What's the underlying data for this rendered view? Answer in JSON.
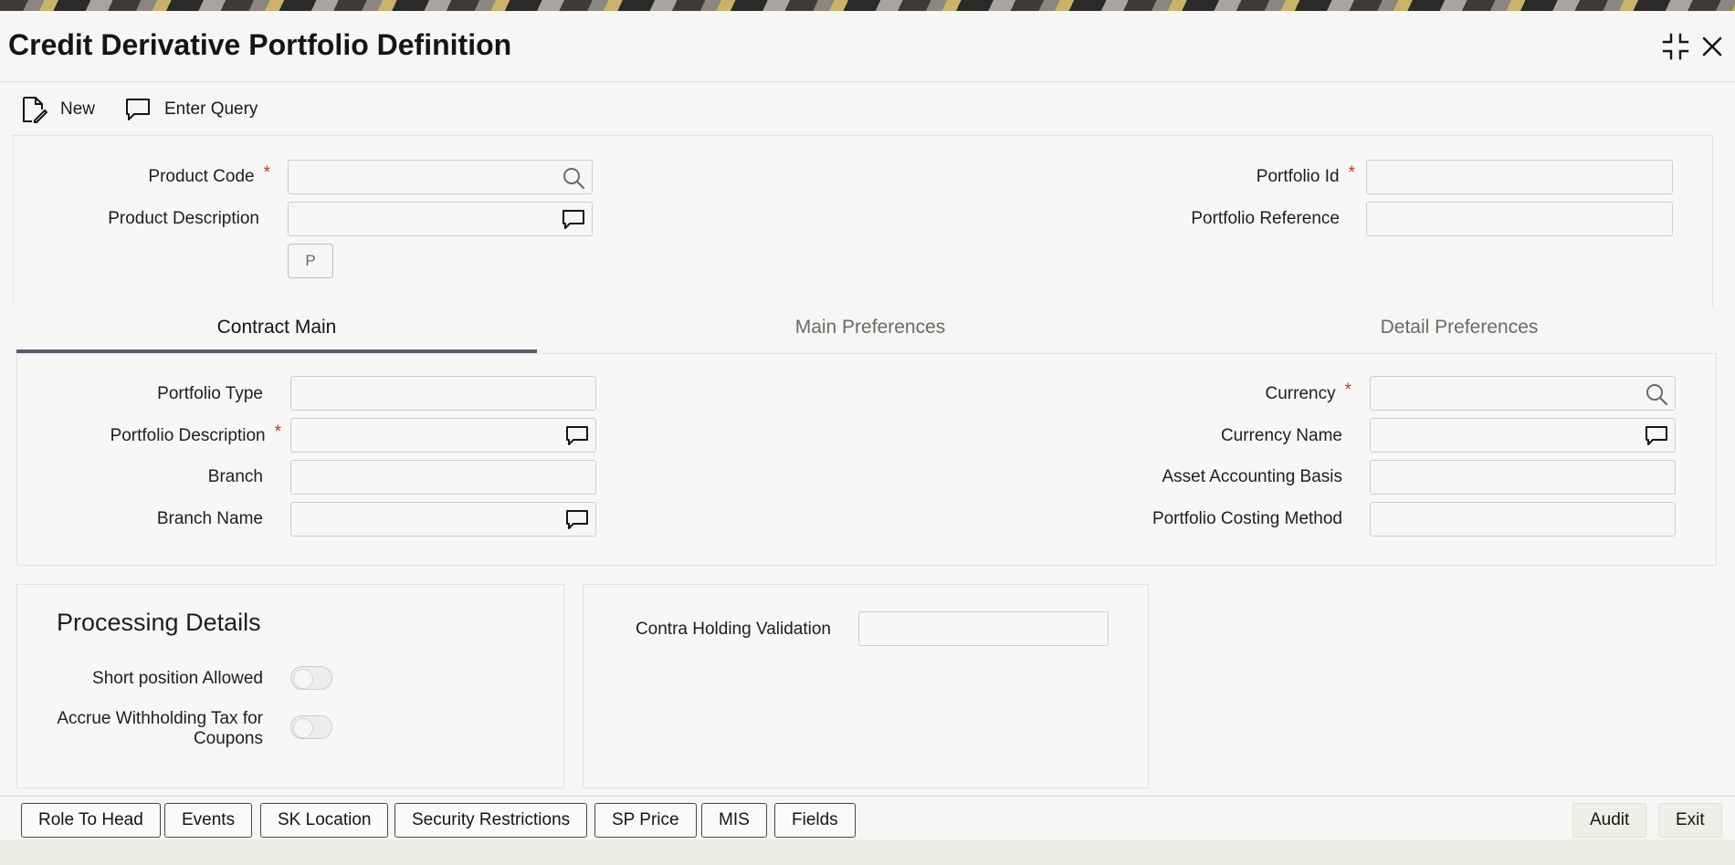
{
  "window": {
    "title": "Credit Derivative Portfolio Definition",
    "maximize_icon": "maximize-icon",
    "close_icon": "close-icon"
  },
  "toolbar": {
    "new_label": "New",
    "enter_query_label": "Enter Query"
  },
  "header": {
    "product_code_label": "Product Code",
    "product_code_value": "",
    "product_description_label": "Product Description",
    "product_description_value": "",
    "p_button_label": "P",
    "portfolio_id_label": "Portfolio Id",
    "portfolio_id_value": "",
    "portfolio_reference_label": "Portfolio Reference",
    "portfolio_reference_value": "",
    "required_mark": "*"
  },
  "tabs": [
    {
      "label": "Contract Main",
      "active": true
    },
    {
      "label": "Main Preferences",
      "active": false
    },
    {
      "label": "Detail Preferences",
      "active": false
    }
  ],
  "contract_main": {
    "portfolio_type_label": "Portfolio Type",
    "portfolio_type_value": "",
    "portfolio_description_label": "Portfolio Description",
    "portfolio_description_value": "",
    "branch_label": "Branch",
    "branch_value": "",
    "branch_name_label": "Branch Name",
    "branch_name_value": "",
    "currency_label": "Currency",
    "currency_value": "",
    "currency_name_label": "Currency Name",
    "currency_name_value": "",
    "asset_accounting_basis_label": "Asset Accounting Basis",
    "asset_accounting_basis_value": "",
    "portfolio_costing_method_label": "Portfolio Costing Method",
    "portfolio_costing_method_value": ""
  },
  "processing": {
    "heading": "Processing Details",
    "short_position_label": "Short position Allowed",
    "short_position_on": false,
    "accrue_wht_label_line1": "Accrue Withholding Tax for",
    "accrue_wht_label_line2": "Coupons",
    "accrue_wht_on": false,
    "contra_holding_label": "Contra Holding Validation",
    "contra_holding_value": ""
  },
  "footer": {
    "buttons": [
      "Role To Head",
      "Events",
      "SK Location",
      "Security Restrictions",
      "SP Price",
      "MIS",
      "Fields"
    ],
    "audit_label": "Audit",
    "exit_label": "Exit"
  },
  "colors": {
    "accent_tab": "#5a5e6e",
    "required": "#c0392b",
    "background": "#f7f6f4"
  }
}
